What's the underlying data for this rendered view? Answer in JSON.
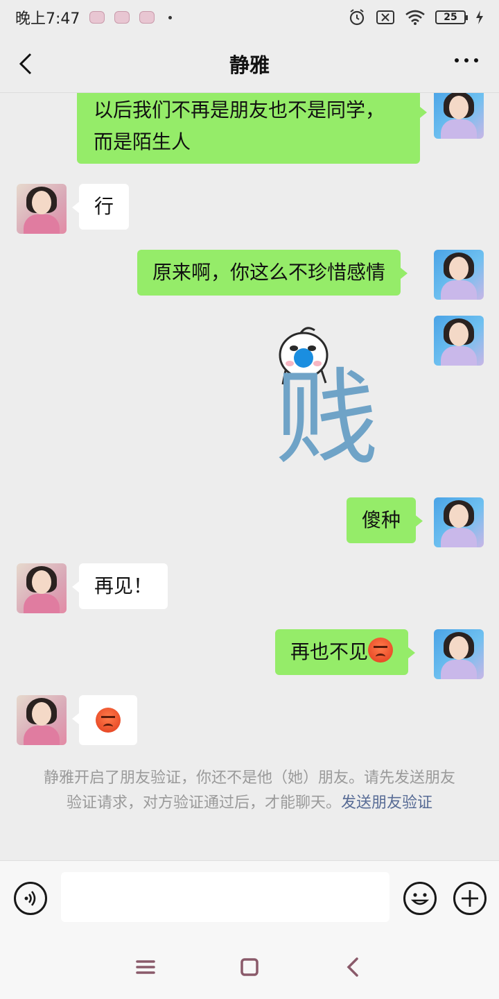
{
  "status_bar": {
    "time": "晚上7:47",
    "battery": "25"
  },
  "header": {
    "title": "静雅",
    "back_icon": "chevron-left-icon",
    "more_icon": "more-dots-icon"
  },
  "messages": [
    {
      "from": "me",
      "text_lines": [
        "以后我们不再是朋友也不是同学，",
        "而是陌生人"
      ]
    },
    {
      "from": "her",
      "text": "行"
    },
    {
      "from": "me",
      "text": "原来啊，你这么不珍惜感情"
    },
    {
      "from": "me",
      "sticker": "贱"
    },
    {
      "from": "me",
      "text": "傻种"
    },
    {
      "from": "her",
      "text": "再见！"
    },
    {
      "from": "me",
      "text": "再也不见",
      "emoji": "angry-face"
    },
    {
      "from": "her",
      "emoji": "angry-face"
    }
  ],
  "system_notice": {
    "text": "静雅开启了朋友验证，你还不是他（她）朋友。请先发送朋友验证请求，对方验证通过后，才能聊天。",
    "link": "发送朋友验证"
  },
  "input_bar": {
    "voice_icon": "voice-icon",
    "emoji_icon": "emoji-icon",
    "plus_icon": "plus-icon",
    "input_value": ""
  },
  "colors": {
    "outgoing_bubble": "#95ec69",
    "incoming_bubble": "#ffffff",
    "background": "#ededed",
    "link": "#576b95"
  }
}
